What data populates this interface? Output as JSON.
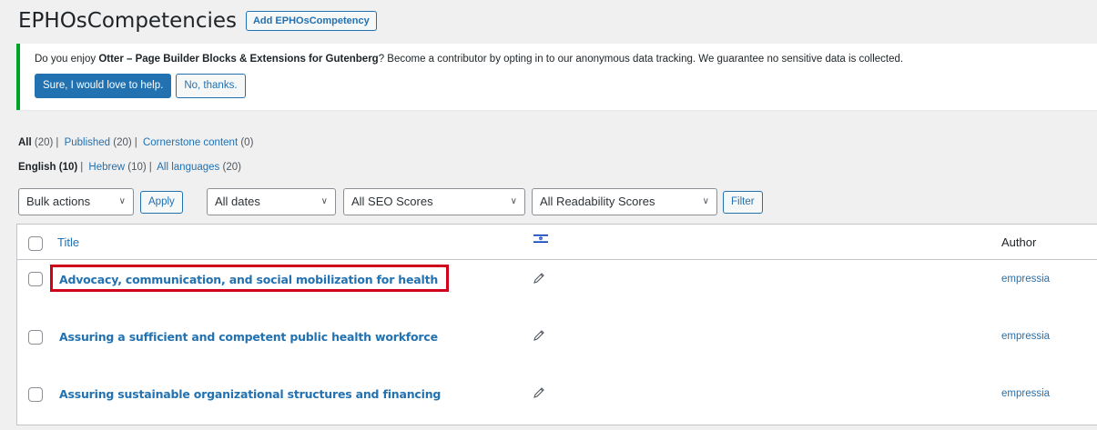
{
  "page": {
    "title": "EPHOsCompetencies",
    "add_button": "Add EPHOsCompetency"
  },
  "notice": {
    "text_before": "Do you enjoy ",
    "text_bold": "Otter – Page Builder Blocks & Extensions for Gutenberg",
    "text_after": "? Become a contributor by opting in to our anonymous data tracking. We guarantee no sensitive data is collected.",
    "accept_label": "Sure, I would love to help.",
    "decline_label": "No, thanks.",
    "border_color": "#00a32a"
  },
  "views": [
    {
      "label": "All",
      "count": "(20)"
    },
    {
      "label": "Published",
      "count": "(20)"
    },
    {
      "label": "Cornerstone content",
      "count": "(0)"
    }
  ],
  "languages": [
    {
      "label": "English",
      "count": "(10)"
    },
    {
      "label": "Hebrew",
      "count": "(10)"
    },
    {
      "label": "All languages",
      "count": "(20)"
    }
  ],
  "filters": {
    "bulk_actions": "Bulk actions",
    "apply_label": "Apply",
    "dates": "All dates",
    "seo": "All SEO Scores",
    "readability": "All Readability Scores",
    "filter_label": "Filter"
  },
  "table": {
    "col_title": "Title",
    "col_language_icon": "israel-flag-icon",
    "col_author": "Author",
    "rows": [
      {
        "title": "Advocacy, communication, and social mobilization for health",
        "author": "empressia",
        "highlighted": true
      },
      {
        "title": "Assuring a sufficient and competent public health workforce",
        "author": "empressia",
        "highlighted": false
      },
      {
        "title": "Assuring sustainable organizational structures and financing",
        "author": "empressia",
        "highlighted": false
      }
    ]
  },
  "colors": {
    "link": "#2271b1",
    "highlight": "#d0021b"
  }
}
